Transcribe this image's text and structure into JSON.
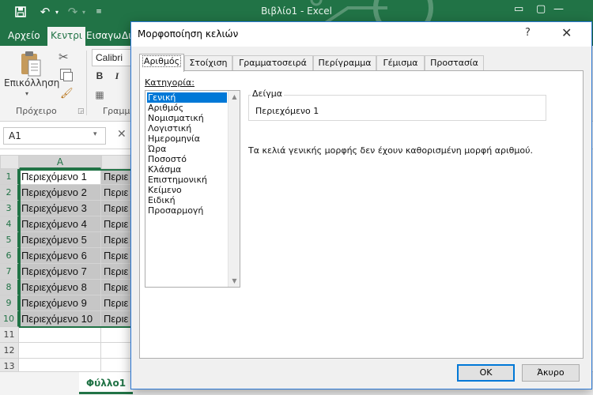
{
  "excel": {
    "window_title": "Βιβλίο1 - Excel",
    "ribbon_tabs": [
      "Αρχείο",
      "Κεντρι",
      "Εισαγω",
      "Δι"
    ],
    "active_tab_index": 1,
    "clipboard": {
      "paste_label": "Επικόλληση",
      "group_label": "Πρόχειρο"
    },
    "font": {
      "font_name": "Calibri",
      "bold_glyph": "B",
      "italic_glyph": "I",
      "group_label_partial": "Γραμμ"
    },
    "name_box": "A1",
    "columns": [
      "A"
    ],
    "rows": [
      "1",
      "2",
      "3",
      "4",
      "5",
      "6",
      "7",
      "8",
      "9",
      "10",
      "11",
      "12",
      "13"
    ],
    "cells_a": [
      "Περιεχόμενο 1",
      "Περιεχόμενο 2",
      "Περιεχόμενο 3",
      "Περιεχόμενο 4",
      "Περιεχόμενο 5",
      "Περιεχόμενο 6",
      "Περιεχόμενο 7",
      "Περιεχόμενο 8",
      "Περιεχόμενο 9",
      "Περιεχόμενο 10"
    ],
    "cells_b_partial": [
      "Περιε",
      "Περιε",
      "Περιε",
      "Περιε",
      "Περιε",
      "Περιε",
      "Περιε",
      "Περιε",
      "Περιε",
      "Περιε"
    ],
    "sheet_tab": "Φύλλο1",
    "accent_color": "#217346"
  },
  "dialog": {
    "title": "Μορφοποίηση κελιών",
    "help_glyph": "?",
    "close_glyph": "✕",
    "tabs": [
      "Αριθμός",
      "Στοίχιση",
      "Γραμματοσειρά",
      "Περίγραμμα",
      "Γέμισμα",
      "Προστασία"
    ],
    "active_tab_index": 0,
    "category_label": "Κατηγορία:",
    "categories": [
      "Γενική",
      "Αριθμός",
      "Νομισματική",
      "Λογιστική",
      "Ημερομηνία",
      "Ώρα",
      "Ποσοστό",
      "Κλάσμα",
      "Επιστημονική",
      "Κείμενο",
      "Ειδική",
      "Προσαρμογή"
    ],
    "selected_category_index": 0,
    "sample_label": "Δείγμα",
    "sample_value": "Περιεχόμενο 1",
    "description": "Τα κελιά γενικής μορφής δεν έχουν καθορισμένη μορφή αριθμού.",
    "ok_label": "OK",
    "cancel_label": "Άκυρο",
    "selection_color": "#0078d7"
  }
}
